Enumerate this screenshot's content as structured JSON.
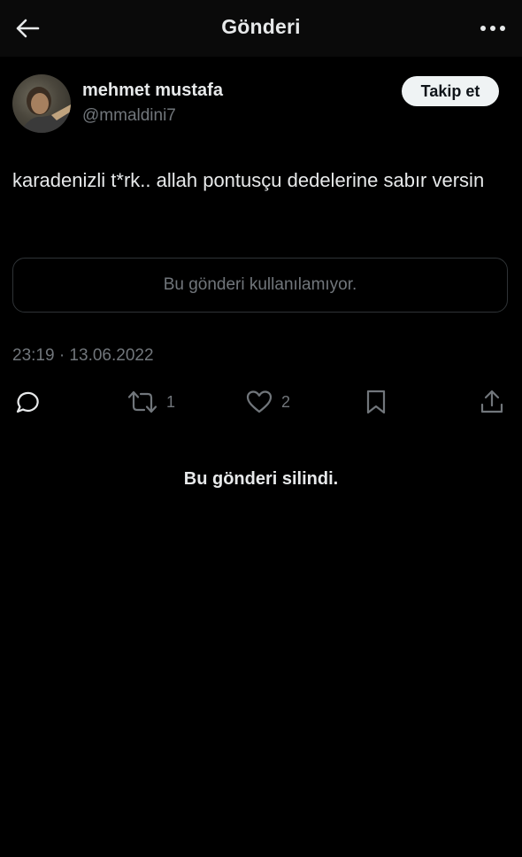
{
  "header": {
    "title": "Gönderi",
    "back_icon": "arrow-left-icon",
    "more_icon": "more-horizontal-icon"
  },
  "author": {
    "name": "mehmet mustafa",
    "handle": "@mmaldini7",
    "follow_label": "Takip et"
  },
  "post": {
    "text": "karadenizli t*rk.. allah pontusçu dedelerine sabır versin",
    "unavailable_text": "Bu gönderi kullanılamıyor.",
    "timestamp": "23:19 · 13.06.2022"
  },
  "actions": {
    "reply_icon": "reply-icon",
    "retweet_icon": "retweet-icon",
    "retweet_count": "1",
    "like_icon": "heart-icon",
    "like_count": "2",
    "bookmark_icon": "bookmark-icon",
    "share_icon": "share-icon"
  },
  "deleted_message": "Bu gönderi silindi.",
  "colors": {
    "background": "#000000",
    "primary_text": "#e7e9ea",
    "secondary_text": "#71767b",
    "border": "#2f3336",
    "follow_button_bg": "#eff3f4"
  }
}
